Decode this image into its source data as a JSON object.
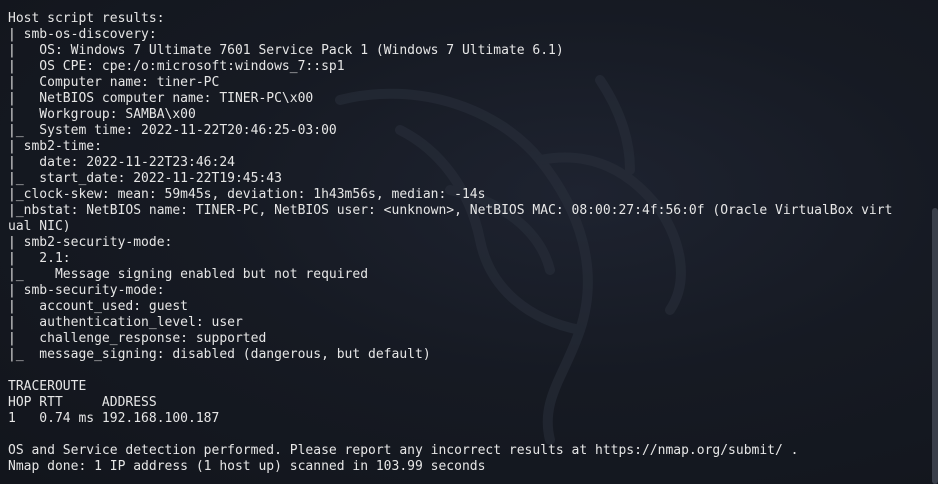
{
  "terminal": {
    "lines": [
      "Host script results:",
      "| smb-os-discovery:",
      "|   OS: Windows 7 Ultimate 7601 Service Pack 1 (Windows 7 Ultimate 6.1)",
      "|   OS CPE: cpe:/o:microsoft:windows_7::sp1",
      "|   Computer name: tiner-PC",
      "|   NetBIOS computer name: TINER-PC\\x00",
      "|   Workgroup: SAMBA\\x00",
      "|_  System time: 2022-11-22T20:46:25-03:00",
      "| smb2-time:",
      "|   date: 2022-11-22T23:46:24",
      "|_  start_date: 2022-11-22T19:45:43",
      "|_clock-skew: mean: 59m45s, deviation: 1h43m56s, median: -14s",
      "|_nbstat: NetBIOS name: TINER-PC, NetBIOS user: <unknown>, NetBIOS MAC: 08:00:27:4f:56:0f (Oracle VirtualBox virt",
      "ual NIC)",
      "| smb2-security-mode:",
      "|   2.1:",
      "|_    Message signing enabled but not required",
      "| smb-security-mode:",
      "|   account_used: guest",
      "|   authentication_level: user",
      "|   challenge_response: supported",
      "|_  message_signing: disabled (dangerous, but default)",
      "",
      "TRACEROUTE",
      "HOP RTT     ADDRESS",
      "1   0.74 ms 192.168.100.187",
      "",
      "OS and Service detection performed. Please report any incorrect results at https://nmap.org/submit/ .",
      "Nmap done: 1 IP address (1 host up) scanned in 103.99 seconds"
    ]
  },
  "colors": {
    "text": "#e6e6e6",
    "background": "#12151c"
  },
  "icons": {
    "watermark": "kali-dragon-icon"
  }
}
